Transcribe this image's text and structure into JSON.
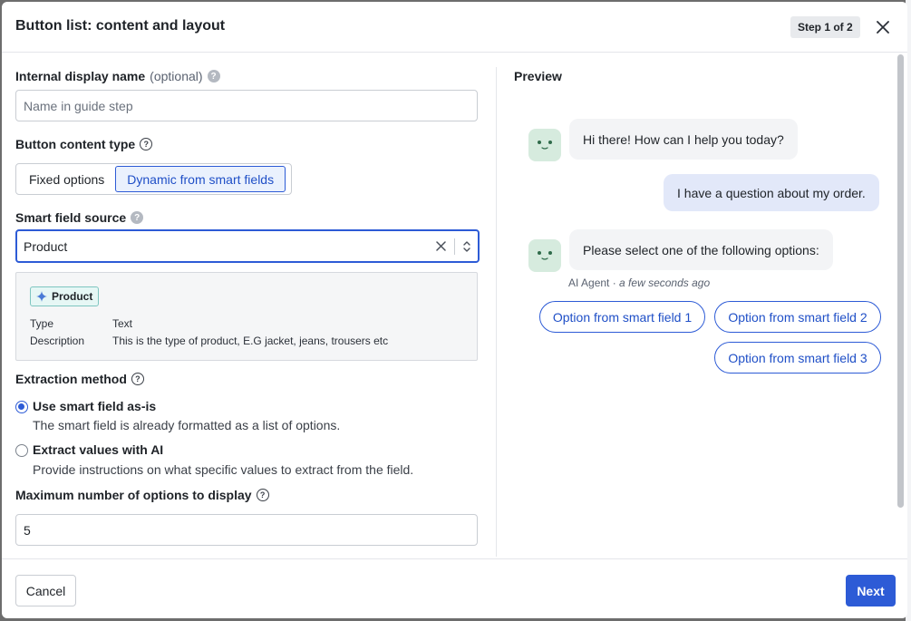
{
  "modal": {
    "title": "Button list: content and layout",
    "step": "Step 1 of 2"
  },
  "form": {
    "display_name": {
      "label": "Internal display name",
      "optional": "(optional)",
      "placeholder": "Name in guide step",
      "value": ""
    },
    "content_type": {
      "label": "Button content type",
      "options": [
        "Fixed options",
        "Dynamic from smart fields"
      ],
      "selected": "Dynamic from smart fields"
    },
    "smart_field_source": {
      "label": "Smart field source",
      "value": "Product"
    },
    "field_info": {
      "chip": "Product",
      "rows": [
        {
          "key": "Type",
          "value": "Text"
        },
        {
          "key": "Description",
          "value": "This is the type of product, E.G jacket, jeans, trousers etc"
        }
      ]
    },
    "extraction": {
      "label": "Extraction method",
      "options": [
        {
          "title": "Use smart field as-is",
          "desc": "The smart field is already formatted as a list of options.",
          "selected": true
        },
        {
          "title": "Extract values with AI",
          "desc": "Provide instructions on what specific values to extract from the field.",
          "selected": false
        }
      ]
    },
    "max_options": {
      "label": "Maximum number of options to display",
      "value": "5"
    }
  },
  "preview": {
    "title": "Preview",
    "messages": [
      {
        "from": "bot",
        "text": "Hi there! How can I help you today?"
      },
      {
        "from": "user",
        "text": "I have a question about my order."
      },
      {
        "from": "bot",
        "text": "Please select one of the following options:"
      }
    ],
    "meta_sender": "AI Agent",
    "meta_sep": " · ",
    "meta_time": "a few seconds ago",
    "option_buttons": [
      "Option from smart field 1",
      "Option from smart field 2",
      "Option from smart field 3"
    ]
  },
  "footer": {
    "cancel": "Cancel",
    "next": "Next"
  },
  "colors": {
    "accent": "#2d5bd6",
    "avatar_bg": "#d6ebde",
    "user_bubble": "#e2e8f9",
    "chip_bg": "#e6f7f5"
  }
}
